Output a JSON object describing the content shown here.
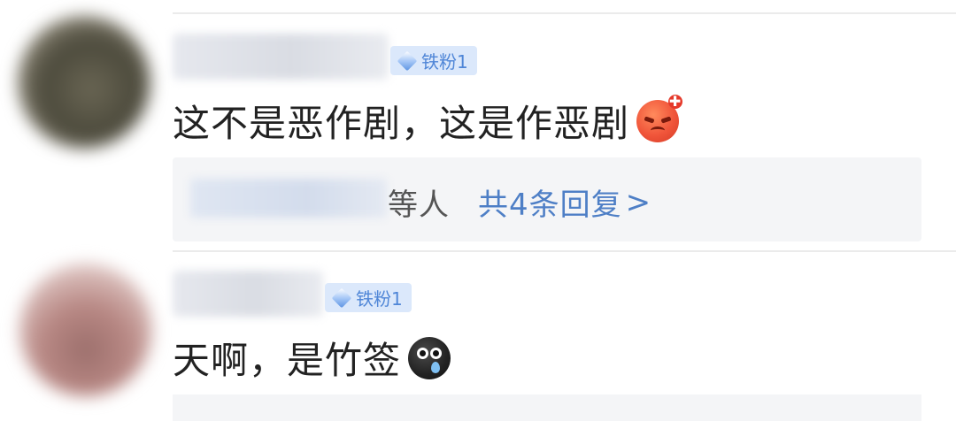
{
  "comments": [
    {
      "badge": "铁粉1",
      "text": "这不是恶作剧，这是作恶剧",
      "emoji": "angry-face-icon",
      "replies": {
        "suffix": "等人",
        "more": "共4条回复",
        "arrow": ">"
      }
    },
    {
      "badge": "铁粉1",
      "text": "天啊，是竹签",
      "emoji": "crying-dark-face-icon"
    }
  ],
  "colors": {
    "badge_bg": "#dbe8fb",
    "badge_text": "#4f86d7",
    "link": "#4e7fc6",
    "reply_bg": "#f4f5f7"
  }
}
